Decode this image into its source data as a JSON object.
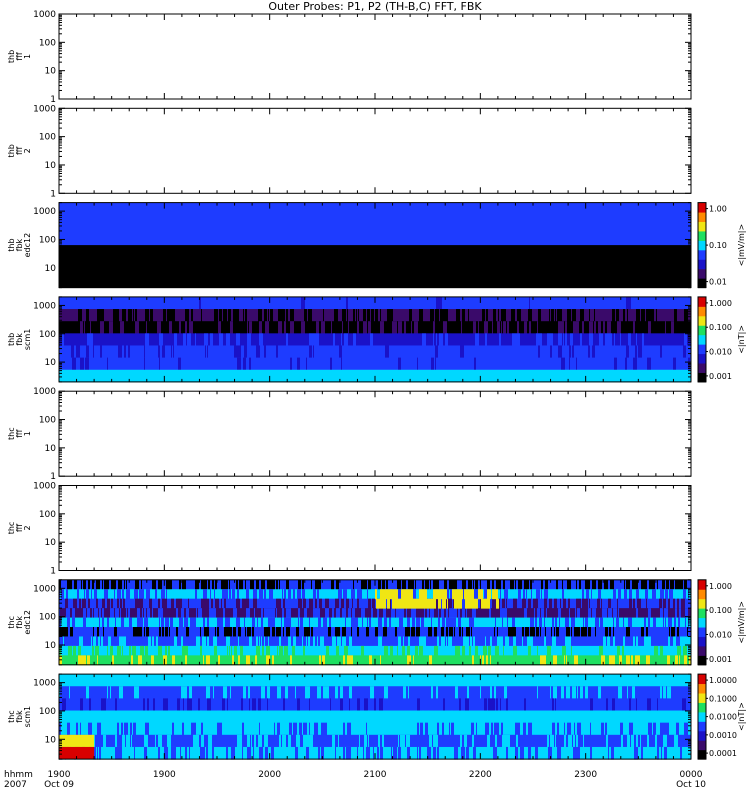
{
  "title": "Outer Probes: P1, P2 (TH-B,C) FFT, FBK",
  "time_axis": {
    "label_line1": "hhmm",
    "label_line2": "2007",
    "ticks": [
      {
        "t": 1900,
        "label": "1900",
        "sub": "Oct 09"
      },
      {
        "t": 1960,
        "label": "1900",
        "sub": ""
      },
      {
        "t": 2020,
        "label": "2000",
        "sub": ""
      },
      {
        "t": 2080,
        "label": "2100",
        "sub": ""
      },
      {
        "t": 2140,
        "label": "2200",
        "sub": ""
      },
      {
        "t": 2200,
        "label": "2300",
        "sub": ""
      },
      {
        "t": 2260,
        "label": "0000",
        "sub": "Oct 10"
      }
    ],
    "range": [
      1900,
      2260
    ]
  },
  "colors": {
    "black": "#000000",
    "purple": "#3a0a6a",
    "dark_blue": "#1a12c8",
    "blue": "#1e3cff",
    "cyan": "#00d8ff",
    "green": "#1ee060",
    "yellow": "#f0e614",
    "orange": "#ff8a00",
    "red": "#d80000"
  },
  "chart_data": [
    {
      "type": "heatmap",
      "ylabel": [
        "thb",
        "fff",
        "1"
      ],
      "y_scale": "log",
      "ylim": [
        1,
        1000
      ],
      "yticks": [
        "1",
        "10",
        "100",
        "1000"
      ],
      "colorbar": null,
      "bands": []
    },
    {
      "type": "heatmap",
      "ylabel": [
        "thb",
        "fff",
        "2"
      ],
      "y_scale": "log",
      "ylim": [
        1,
        1000
      ],
      "yticks": [
        "1",
        "10",
        "100",
        "1000"
      ],
      "colorbar": null,
      "bands": []
    },
    {
      "type": "heatmap",
      "ylabel": [
        "thb",
        "fbk",
        "edc12"
      ],
      "y_scale": "log",
      "ylim": [
        2,
        2000
      ],
      "yticks": [
        "10",
        "100",
        "1000"
      ],
      "colorbar": {
        "label": "<|mV/m|>",
        "ticks": [
          "0.01",
          "0.10",
          "1.00"
        ]
      },
      "bands": [
        {
          "name": "top",
          "color": "blue",
          "alt": "dark_blue",
          "var": 0.0
        },
        {
          "name": "main",
          "color": "black",
          "alt": "black",
          "var": 0.0
        }
      ]
    },
    {
      "type": "heatmap",
      "ylabel": [
        "thb",
        "fbk",
        "scm1"
      ],
      "y_scale": "log",
      "ylim": [
        2,
        2000
      ],
      "yticks": [
        "10",
        "100",
        "1000"
      ],
      "colorbar": {
        "label": "<|nT|>",
        "ticks": [
          "0.001",
          "0.010",
          "0.100",
          "1.000"
        ]
      },
      "bands": [
        {
          "name": "b1",
          "color": "blue",
          "alt": "dark_blue",
          "var": 0.05
        },
        {
          "name": "b2",
          "color": "purple",
          "alt": "black",
          "var": 0.6
        },
        {
          "name": "b3",
          "color": "black",
          "alt": "purple",
          "var": 0.4
        },
        {
          "name": "b4",
          "color": "dark_blue",
          "alt": "blue",
          "var": 0.3
        },
        {
          "name": "b5",
          "color": "blue",
          "alt": "dark_blue",
          "var": 0.25
        },
        {
          "name": "b6",
          "color": "blue",
          "alt": "dark_blue",
          "var": 0.1
        },
        {
          "name": "b7",
          "color": "cyan",
          "alt": "cyan",
          "var": 0.0
        }
      ]
    },
    {
      "type": "heatmap",
      "ylabel": [
        "thc",
        "fff",
        "1"
      ],
      "y_scale": "log",
      "ylim": [
        1,
        1000
      ],
      "yticks": [
        "1",
        "10",
        "100",
        "1000"
      ],
      "colorbar": null,
      "bands": []
    },
    {
      "type": "heatmap",
      "ylabel": [
        "thc",
        "fff",
        "2"
      ],
      "y_scale": "log",
      "ylim": [
        1,
        1000
      ],
      "yticks": [
        "1",
        "10",
        "100",
        "1000"
      ],
      "colorbar": null,
      "bands": []
    },
    {
      "type": "heatmap",
      "ylabel": [
        "thc",
        "fbk",
        "edc12"
      ],
      "y_scale": "log",
      "ylim": [
        2,
        2000
      ],
      "yticks": [
        "10",
        "100",
        "1000"
      ],
      "colorbar": {
        "label": "<|mV/m|>",
        "ticks": [
          "0.001",
          "0.010",
          "0.100",
          "1.000"
        ]
      },
      "bands": [
        {
          "name": "b1",
          "color": "blue",
          "alt": "black",
          "var": 0.7
        },
        {
          "name": "b2",
          "color": "cyan",
          "alt": "blue",
          "var": 0.6
        },
        {
          "name": "b3",
          "color": "blue",
          "alt": "purple",
          "var": 0.6
        },
        {
          "name": "b4",
          "color": "purple",
          "alt": "blue",
          "var": 0.6
        },
        {
          "name": "b5",
          "color": "cyan",
          "alt": "blue",
          "var": 0.6
        },
        {
          "name": "b6",
          "color": "blue",
          "alt": "black",
          "var": 0.55
        },
        {
          "name": "b7",
          "color": "blue",
          "alt": "cyan",
          "var": 0.5
        },
        {
          "name": "b8",
          "color": "cyan",
          "alt": "green",
          "var": 0.4
        },
        {
          "name": "b9",
          "color": "green",
          "alt": "yellow",
          "var": 0.3
        }
      ],
      "overlay": {
        "from": 2080,
        "to": 2150,
        "rows": [
          1,
          2
        ],
        "color": "yellow"
      }
    },
    {
      "type": "heatmap",
      "ylabel": [
        "thc",
        "fbk",
        "scm1"
      ],
      "y_scale": "log",
      "ylim": [
        2,
        2000
      ],
      "yticks": [
        "10",
        "100",
        "1000"
      ],
      "colorbar": {
        "label": "<|nT|>",
        "ticks": [
          "0.0001",
          "0.0010",
          "0.0100",
          "0.1000",
          "1.0000"
        ]
      },
      "bands": [
        {
          "name": "b1",
          "color": "cyan",
          "alt": "cyan",
          "var": 0.0
        },
        {
          "name": "b2",
          "color": "blue",
          "alt": "cyan",
          "var": 0.35
        },
        {
          "name": "b3",
          "color": "blue",
          "alt": "dark_blue",
          "var": 0.3
        },
        {
          "name": "b4",
          "color": "cyan",
          "alt": "cyan",
          "var": 0.05
        },
        {
          "name": "b5",
          "color": "cyan",
          "alt": "blue",
          "var": 0.4
        },
        {
          "name": "b6",
          "color": "blue",
          "alt": "cyan",
          "var": 0.45
        },
        {
          "name": "b7",
          "color": "cyan",
          "alt": "blue",
          "var": 0.4
        }
      ],
      "left_patch": {
        "to": 1920,
        "colors": [
          "yellow",
          "red"
        ]
      }
    }
  ]
}
